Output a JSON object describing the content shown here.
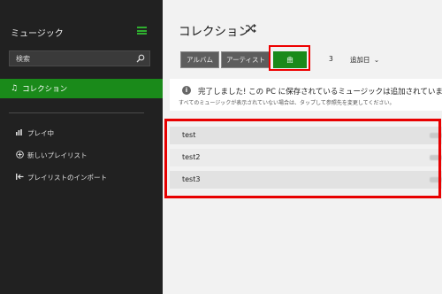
{
  "sidebar": {
    "title": "ミュージック",
    "search_placeholder": "検索",
    "collection_label": "コレクション",
    "items": [
      {
        "label": "プレイ中",
        "icon": "now-playing-icon"
      },
      {
        "label": "新しいプレイリスト",
        "icon": "add-icon"
      },
      {
        "label": "プレイリストのインポート",
        "icon": "import-icon"
      }
    ]
  },
  "main": {
    "title": "コレクション",
    "tabs": {
      "album": "アルバム",
      "artist": "アーティスト",
      "song": "曲"
    },
    "count": "3",
    "sort_label": "追加日",
    "notice": {
      "title": "完了しました! この PC に保存されているミュージックは追加されています。",
      "subtitle": "すべてのミュージックが表示されていない場合は、タップして参照先を変更してください。"
    },
    "songs": [
      "test",
      "test2",
      "test3"
    ]
  },
  "colors": {
    "accent": "#1a8a1a",
    "highlight": "#ee0000",
    "sidebar": "#212121"
  }
}
